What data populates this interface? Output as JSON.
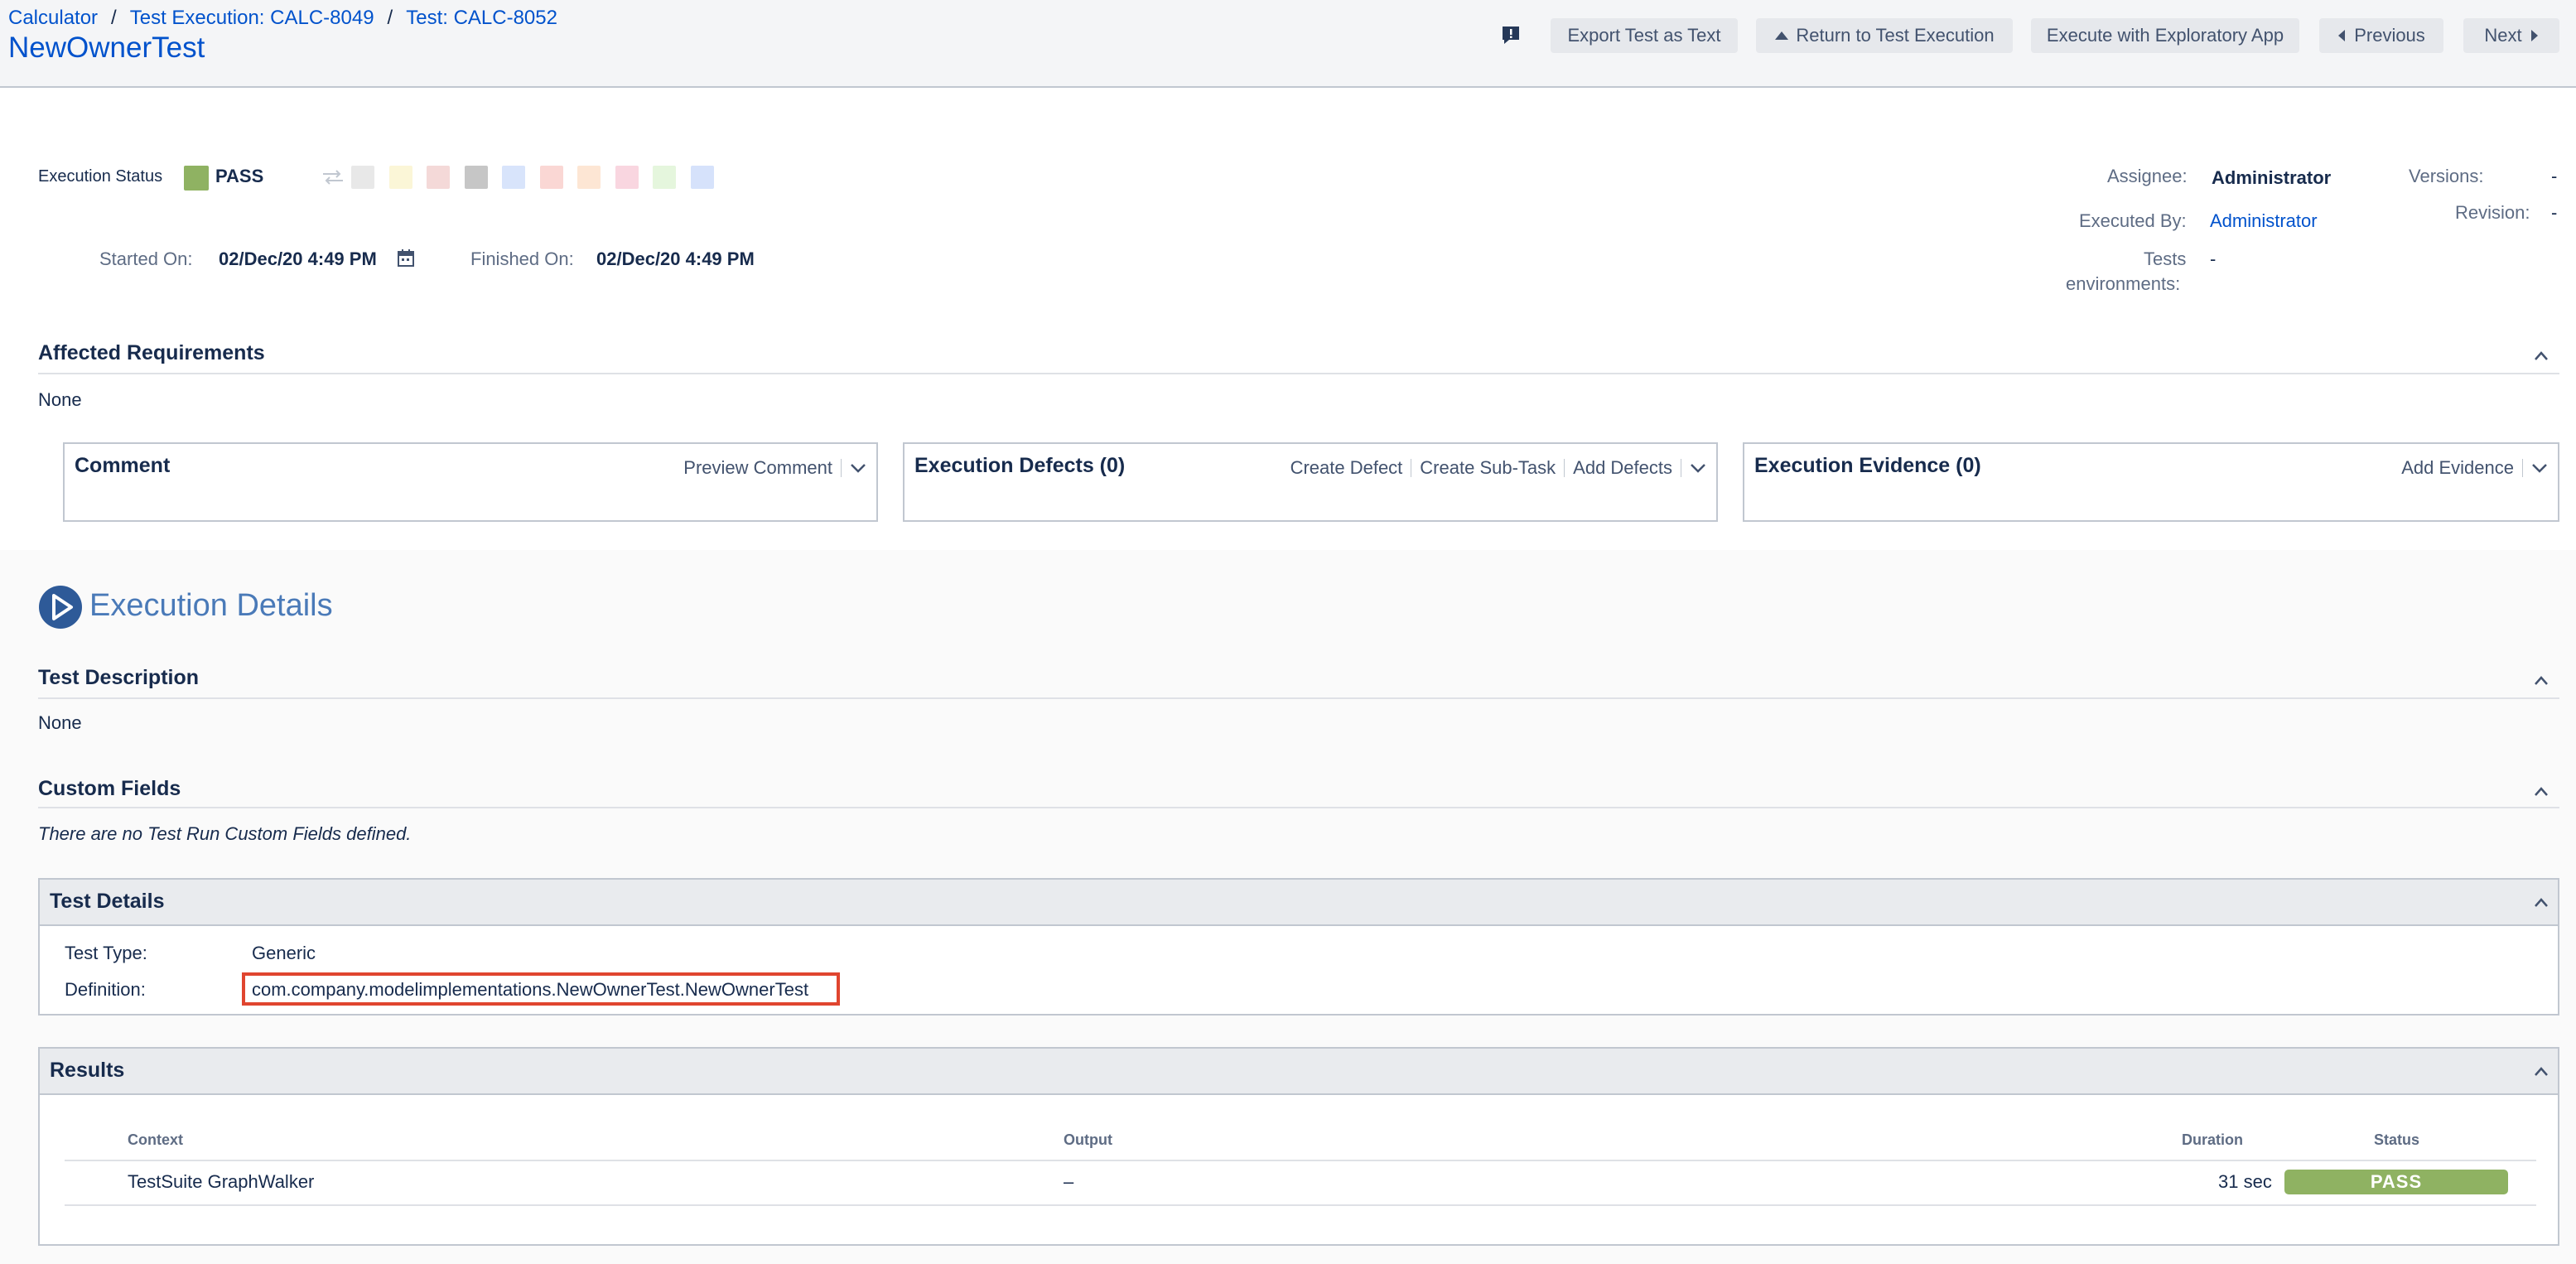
{
  "breadcrumb": {
    "items": [
      "Calculator",
      "Test Execution: CALC-8049",
      "Test: CALC-8052"
    ],
    "separator": "/"
  },
  "page_title": "NewOwnerTest",
  "toolbar": {
    "export_label": "Export Test as Text",
    "return_label": "Return to Test Execution",
    "exploratory_label": "Execute with Exploratory App",
    "previous_label": "Previous",
    "next_label": "Next"
  },
  "execution": {
    "status_label": "Execution Status",
    "status_value": "PASS",
    "status_color": "#8fb262",
    "started_label": "Started On:",
    "started_value": "02/Dec/20 4:49 PM",
    "finished_label": "Finished On:",
    "finished_value": "02/Dec/20 4:49 PM",
    "assignee_label": "Assignee:",
    "assignee_value": "Administrator",
    "executed_by_label": "Executed By:",
    "executed_by_value": "Administrator",
    "tests_env_label_1": "Tests",
    "tests_env_label_2": "environments:",
    "tests_env_value": "-",
    "versions_label": "Versions:",
    "versions_value": "-",
    "revision_label": "Revision:",
    "revision_value": "-",
    "status_swatches": [
      "#e8e8e8",
      "#fbf6d7",
      "#f4d9d8",
      "#c6c6c6",
      "#d8e4fb",
      "#fad7d4",
      "#fde6d4",
      "#f9d6e0",
      "#e5f6dd",
      "#d6e2fb"
    ]
  },
  "affected_requirements": {
    "title": "Affected Requirements",
    "value": "None"
  },
  "panels": {
    "comment": {
      "title": "Comment",
      "preview": "Preview Comment"
    },
    "defects": {
      "title": "Execution Defects (0)",
      "create_defect": "Create Defect",
      "create_subtask": "Create Sub-Task",
      "add_defects": "Add Defects"
    },
    "evidence": {
      "title": "Execution Evidence (0)",
      "add_evidence": "Add Evidence"
    }
  },
  "execution_details": {
    "title": "Execution Details",
    "test_description_title": "Test Description",
    "test_description_value": "None",
    "custom_fields_title": "Custom Fields",
    "custom_fields_value": "There are no Test Run Custom Fields defined."
  },
  "test_details": {
    "title": "Test Details",
    "type_label": "Test Type:",
    "type_value": "Generic",
    "definition_label": "Definition:",
    "definition_value": "com.company.modelimplementations.NewOwnerTest.NewOwnerTest"
  },
  "results": {
    "title": "Results",
    "columns": {
      "context": "Context",
      "output": "Output",
      "duration": "Duration",
      "status": "Status"
    },
    "rows": [
      {
        "context": "TestSuite GraphWalker",
        "output": "–",
        "duration": "31 sec",
        "status": "PASS"
      }
    ]
  }
}
